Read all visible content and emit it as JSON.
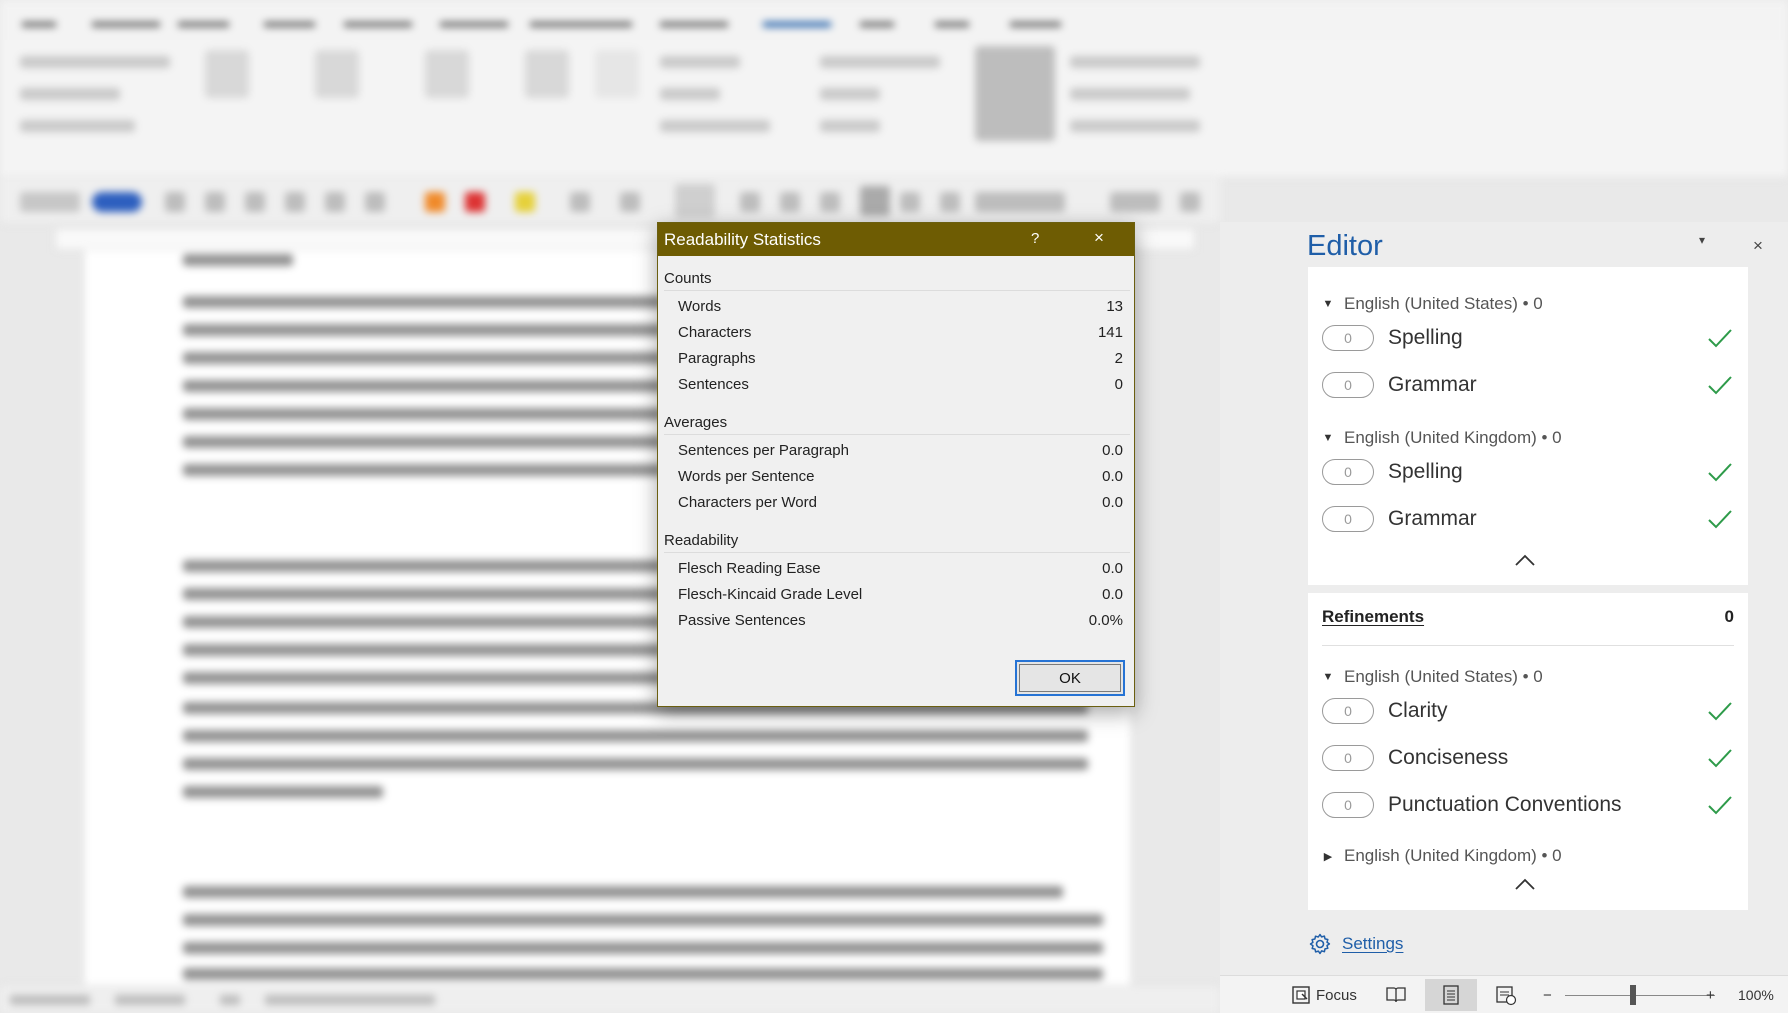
{
  "dialog": {
    "title": "Readability Statistics",
    "help_label": "?",
    "close_label": "×",
    "sections": [
      {
        "title": "Counts",
        "stats": [
          {
            "label": "Words",
            "value": "13"
          },
          {
            "label": "Characters",
            "value": "141"
          },
          {
            "label": "Paragraphs",
            "value": "2"
          },
          {
            "label": "Sentences",
            "value": "0"
          }
        ]
      },
      {
        "title": "Averages",
        "stats": [
          {
            "label": "Sentences per Paragraph",
            "value": "0.0"
          },
          {
            "label": "Words per Sentence",
            "value": "0.0"
          },
          {
            "label": "Characters per Word",
            "value": "0.0"
          }
        ]
      },
      {
        "title": "Readability",
        "stats": [
          {
            "label": "Flesch Reading Ease",
            "value": "0.0"
          },
          {
            "label": "Flesch-Kincaid Grade Level",
            "value": "0.0"
          },
          {
            "label": "Passive Sentences",
            "value": "0.0%"
          }
        ]
      }
    ],
    "ok_label": "OK",
    "titlebar_color": "#6e5c03"
  },
  "editor": {
    "title": "Editor",
    "close_label": "×",
    "corrections": {
      "groups": [
        {
          "language": "English (United States) • 0",
          "items": [
            {
              "label": "Spelling",
              "count": "0"
            },
            {
              "label": "Grammar",
              "count": "0"
            }
          ]
        },
        {
          "language": "English (United Kingdom) • 0",
          "items": [
            {
              "label": "Spelling",
              "count": "0"
            },
            {
              "label": "Grammar",
              "count": "0"
            }
          ]
        }
      ]
    },
    "refinements": {
      "title": "Refinements",
      "count": "0",
      "groups": [
        {
          "language": "English (United States) • 0",
          "items": [
            {
              "label": "Clarity",
              "count": "0"
            },
            {
              "label": "Conciseness",
              "count": "0"
            },
            {
              "label": "Punctuation Conventions",
              "count": "0"
            }
          ]
        },
        {
          "language": "English (United Kingdom) • 0"
        }
      ]
    },
    "settings_label": "Settings",
    "accent_color": "#1f5ea8",
    "check_color": "#2e9b4a"
  },
  "statusbar": {
    "focus_label": "Focus",
    "zoom_minus": "−",
    "zoom_plus": "+",
    "zoom_level": "100%"
  }
}
